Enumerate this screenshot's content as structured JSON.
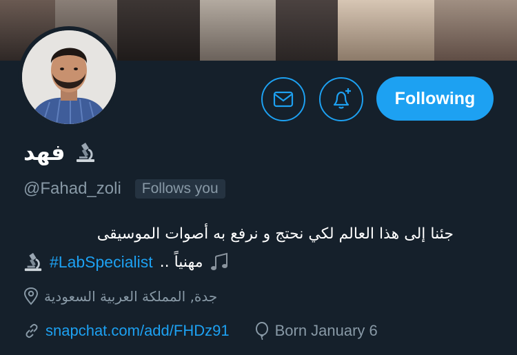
{
  "profile": {
    "name": "فهد",
    "handle": "@Fahad_zoli",
    "follows_you": "Follows you",
    "bio_line1": "جئنا إلى هذا العالم لكي نحتج و نرفع به أصوات الموسيقى",
    "bio_text2": "مهنياً ..",
    "hashtag": "#LabSpecialist",
    "location": "جدة, المملكة العربية السعودية",
    "link": "snapchat.com/add/FHDz91",
    "born": "Born January 6"
  },
  "actions": {
    "follow_label": "Following"
  },
  "icons": {
    "message": "envelope-icon",
    "notify": "bell-plus-icon",
    "location": "location-pin-icon",
    "link": "link-icon",
    "born": "balloon-icon",
    "emoji": "microscope-icon",
    "music": "music-notes-icon"
  },
  "colors": {
    "background": "#15202b",
    "accent": "#1da1f2",
    "muted": "#8899a6",
    "badge_bg": "#253341"
  }
}
